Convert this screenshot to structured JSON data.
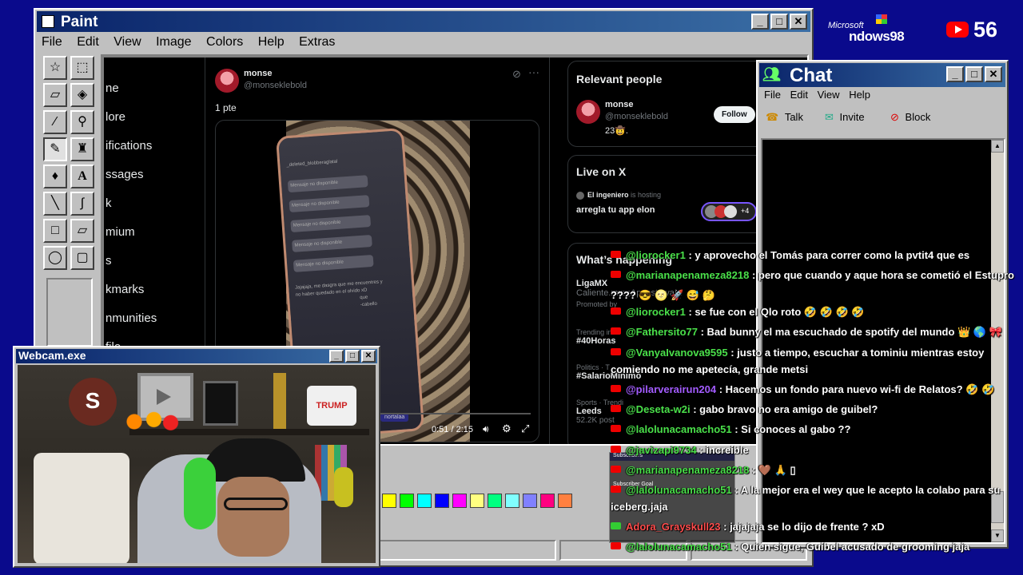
{
  "desktop": {
    "win98_logo_small": "Microsoft",
    "win98_logo_big": "ndows98",
    "youtube_count": "56"
  },
  "paint": {
    "title": "Paint",
    "menu": [
      "File",
      "Edit",
      "View",
      "Image",
      "Colors",
      "Help",
      "Extras"
    ],
    "tools": [
      "free-select",
      "rect-select",
      "eraser",
      "fill",
      "color-picker",
      "magnifier",
      "pencil",
      "brush",
      "airbrush",
      "text",
      "line",
      "curve",
      "rectangle",
      "polygon",
      "ellipse",
      "rounded-rectangle"
    ],
    "palette": [
      "#000000",
      "#ffff00",
      "#00ff00",
      "#00ffff",
      "#0000ff",
      "#ff00ff",
      "#ffff80",
      "#00ff80",
      "#80ffff",
      "#8080ff",
      "#ff0080",
      "#ff8040"
    ],
    "status": ""
  },
  "x": {
    "nav": [
      "ne",
      "lore",
      "ifications",
      "ssages",
      "k",
      "mium",
      "s",
      "kmarks",
      "nmunities",
      "file"
    ],
    "post": {
      "name": "monse",
      "handle": "@monseklebold",
      "text": "1 pte",
      "video_time": "0:51 / 2:15",
      "phone_lines": [
        "_deleted_blobberaglatal",
        "Mensaje no disponible",
        "Mensaje no disponible",
        "Mensaje no disponible",
        "Mensaje no disponible",
        "Mensaje no disponible",
        "Jajajaja, me dasgra que me encuentres y no haber quedado en el olvido xD",
        "que",
        "-cabello"
      ],
      "phone_chip": "nortalaa"
    },
    "relevant": {
      "heading": "Relevant people",
      "name": "monse",
      "handle": "@monseklebold",
      "bio": "23🤠.",
      "follow": "Follow"
    },
    "live": {
      "heading": "Live on X",
      "host_name": "El ingeniero",
      "host_suffix": "is hosting",
      "title": "arregla tu app elon",
      "more": "+4"
    },
    "happening": {
      "heading": "What’s happening",
      "items": [
        {
          "title": "LigaMX",
          "sub": "Caliente.mx: ¡Apuesta ya!"
        },
        {
          "title": "",
          "sub": "Promoted by"
        },
        {
          "cat": "Trending in",
          "title": "#40Horas"
        },
        {
          "cat": "Politics · T",
          "title": "#SalarioMínimo"
        },
        {
          "cat": "Sports · Trendi",
          "title": "Leeds",
          "sub": "52.2K post"
        }
      ]
    }
  },
  "chat_window": {
    "title": "Chat",
    "menu": [
      "File",
      "Edit",
      "View",
      "Help"
    ],
    "toolbar": [
      "Talk",
      "Invite",
      "Block"
    ]
  },
  "webcam": {
    "title": "Webcam.exe",
    "props": [
      "S",
      "TRUMP"
    ]
  },
  "overlay_widget": {
    "title": "Subscribers",
    "goal": "Subscriber Goal"
  },
  "stream_chat": [
    {
      "user": "@liorocker1",
      "user_color": "#4ae04a",
      "msg": " : y aprovecho el Tomás para correr como la pvtit4 que es"
    },
    {
      "user": "@marianapenameza8218",
      "user_color": "#4ae04a",
      "msg": " : pero que cuando y aque hora se cometió el Estupro"
    },
    {
      "user": "",
      "user_color": "#ffffff",
      "msg": "???? 😎 🌝 🚀 😅 🤔"
    },
    {
      "user": "@liorocker1",
      "user_color": "#4ae04a",
      "msg": " : se fue con el Qlo roto 🤣 🤣 🤣 🤣"
    },
    {
      "user": "@Fathersito77",
      "user_color": "#4ae04a",
      "msg": " : Bad bunny el ma escuchado de spotify del mundo 👑 🌎 🎀"
    },
    {
      "user": "@VanyaIvanova9595",
      "user_color": "#4ae04a",
      "msg": " : justo a tiempo, escuchar a tominiu mientras estoy"
    },
    {
      "user": "",
      "user_color": "#ffffff",
      "msg": "comiendo no me apetecía, grande metsi"
    },
    {
      "user": "@pilarverairun204",
      "user_color": "#a35cff",
      "msg": " : Hacemos un fondo para nuevo wi-fi de Relatos? 🤣 🤣"
    },
    {
      "user": "@Deseta-w2i",
      "user_color": "#4ae04a",
      "msg": " : gabo bravo no era amigo de guibel?"
    },
    {
      "user": "@lalolunacamacho51",
      "user_color": "#4ae04a",
      "msg": " : Si conoces al gabo ??"
    },
    {
      "user": "@javizapi9734",
      "user_color": "#4ae04a",
      "msg": " : increible"
    },
    {
      "user": "@marianapenameza8218",
      "user_color": "#4ae04a",
      "msg": " : 🤎 🙏 ▯"
    },
    {
      "user": "@lalolunacamacho51",
      "user_color": "#4ae04a",
      "msg": " : A la mejor era el wey que le acepto la colabo para su"
    },
    {
      "user": "",
      "user_color": "#ffffff",
      "msg": "iceberg.jaja"
    },
    {
      "user": "Adora_Grayskull23",
      "user_color": "#ff4d4d",
      "msg": " : jajajaja se lo dijo de frente ? xD"
    },
    {
      "user": "@lalolunacamacho51",
      "user_color": "#4ae04a",
      "msg": " : Quien sigue, Guibel acusado de grooming jaja"
    }
  ]
}
